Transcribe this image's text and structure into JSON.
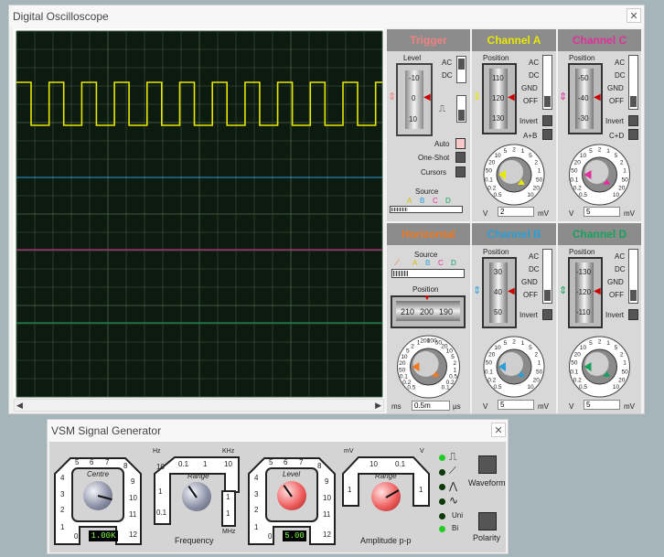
{
  "oscilloscope": {
    "title": "Digital Oscilloscope",
    "close_label": "✕",
    "trigger": {
      "header": "Trigger",
      "level_label": "Level",
      "ticks": [
        "-10",
        "0",
        "10"
      ],
      "ac": "AC",
      "dc": "DC",
      "auto": "Auto",
      "one_shot": "One-Shot",
      "cursors": "Cursors",
      "source_label": "Source",
      "sources": [
        "A",
        "B",
        "C",
        "D"
      ]
    },
    "channel_a": {
      "header": "Channel A",
      "position_label": "Position",
      "ticks": [
        "110",
        "120",
        "130"
      ],
      "ac": "AC",
      "dc": "DC",
      "gnd": "GND",
      "off": "OFF",
      "invert": "Invert",
      "combine": "A+B",
      "dial": [
        "0.5",
        "0.2",
        "0.1",
        "50",
        "20",
        "10",
        "5",
        "2",
        "1",
        "5",
        "2",
        "1",
        "50",
        "20",
        "10"
      ],
      "v": "V",
      "value": "2",
      "mv": "mV"
    },
    "channel_b": {
      "header": "Channel B",
      "position_label": "Position",
      "ticks": [
        "30",
        "40",
        "50"
      ],
      "ac": "AC",
      "dc": "DC",
      "gnd": "GND",
      "off": "OFF",
      "invert": "Invert",
      "dial": [
        "0.5",
        "0.2",
        "0.1",
        "50",
        "20",
        "10",
        "5",
        "2",
        "1",
        "5",
        "2",
        "1",
        "50",
        "20",
        "10"
      ],
      "v": "V",
      "value": "5",
      "mv": "mV"
    },
    "channel_c": {
      "header": "Channel C",
      "position_label": "Position",
      "ticks": [
        "-50",
        "-40",
        "-30"
      ],
      "ac": "AC",
      "dc": "DC",
      "gnd": "GND",
      "off": "OFF",
      "invert": "Invert",
      "combine": "C+D",
      "dial": [
        "0.5",
        "0.2",
        "0.1",
        "50",
        "20",
        "10",
        "5",
        "2",
        "1",
        "5",
        "2",
        "1",
        "50",
        "20",
        "10"
      ],
      "v": "V",
      "value": "5",
      "mv": "mV"
    },
    "channel_d": {
      "header": "Channel D",
      "position_label": "Position",
      "ticks": [
        "-130",
        "-120",
        "-110"
      ],
      "ac": "AC",
      "dc": "DC",
      "gnd": "GND",
      "off": "OFF",
      "invert": "Invert",
      "dial": [
        "0.5",
        "0.2",
        "0.1",
        "50",
        "20",
        "10",
        "5",
        "2",
        "1",
        "5",
        "2",
        "1",
        "50",
        "20",
        "10"
      ],
      "v": "V",
      "value": "5",
      "mv": "mV"
    },
    "horizontal": {
      "header": "Horizontal",
      "source_label": "Source",
      "sources": [
        "A",
        "B",
        "C",
        "D"
      ],
      "position_label": "Position",
      "position_ticks": [
        "210",
        "200",
        "190"
      ],
      "dial": [
        "0.5",
        "0.2",
        "0.1",
        "50",
        "20",
        "10",
        "5",
        "2",
        "1",
        "200",
        "100",
        "50",
        "20",
        "10",
        "5",
        "2",
        "1",
        "0.5",
        "0.2",
        "0.1"
      ],
      "ms": "ms",
      "value": "0.5m",
      "us": "µs"
    },
    "colors": {
      "channel_a": "#e8e800",
      "channel_b": "#2a9fd6",
      "channel_c": "#e0309a",
      "channel_d": "#17a25c",
      "trigger": "#f08080",
      "horizontal": "#f07820"
    }
  },
  "signal_generator": {
    "title": "VSM Signal Generator",
    "close_label": "✕",
    "centre": {
      "label": "Centre",
      "ticks": [
        "5",
        "6",
        "7",
        "8",
        "9",
        "10",
        "11",
        "12",
        "0",
        "1",
        "2",
        "3",
        "4"
      ],
      "display": "1.00K"
    },
    "freq_range": {
      "label": "Range",
      "ticks": [
        "0.1",
        "1",
        "10"
      ],
      "side_left": [
        "10",
        "1",
        "0.1"
      ],
      "side_right": [
        "1",
        "1"
      ],
      "hz": "Hz",
      "khz": "KHz",
      "mhz": "MHz"
    },
    "frequency_label": "Frequency",
    "level": {
      "label": "Level",
      "ticks": [
        "5",
        "6",
        "7",
        "8",
        "9",
        "10",
        "11",
        "12",
        "0",
        "1",
        "2",
        "3",
        "4"
      ],
      "display": "5.00"
    },
    "amp_range": {
      "label": "Range",
      "ticks": [
        "10",
        "0.1"
      ],
      "side_left": [
        "1"
      ],
      "side_right": [
        "1"
      ],
      "mv": "mV",
      "v": "V"
    },
    "amplitude_label": "Amplitude p-p",
    "waveform_label": "Waveform",
    "uni": "Uni",
    "bi": "Bi",
    "polarity_label": "Polarity"
  }
}
